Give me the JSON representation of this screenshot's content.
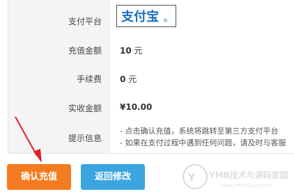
{
  "rows": {
    "platform": {
      "label": "支付平台",
      "logo_text": "支付宝"
    },
    "amount": {
      "label": "充值金额",
      "value": "10",
      "unit": "元"
    },
    "fee": {
      "label": "手续费",
      "value": "0",
      "unit": "元"
    },
    "received": {
      "label": "实收金额",
      "value": "¥10.00"
    },
    "notice": {
      "label": "提示信息",
      "lines": [
        "- 点击确认充值，系统将跳转至第三方支付平台",
        "- 如果在支付过程中遇到任何问题，请及时与客服"
      ]
    }
  },
  "buttons": {
    "confirm": "确认充值",
    "back": "返回修改"
  },
  "watermark": {
    "main": "YMB技术与源码家园",
    "sub": "www.ymb95pub.com"
  },
  "colors": {
    "confirm_bg": "#f47b20",
    "back_bg": "#3aa5df",
    "amount_red": "#d0021b",
    "arrow": "#e02020"
  }
}
